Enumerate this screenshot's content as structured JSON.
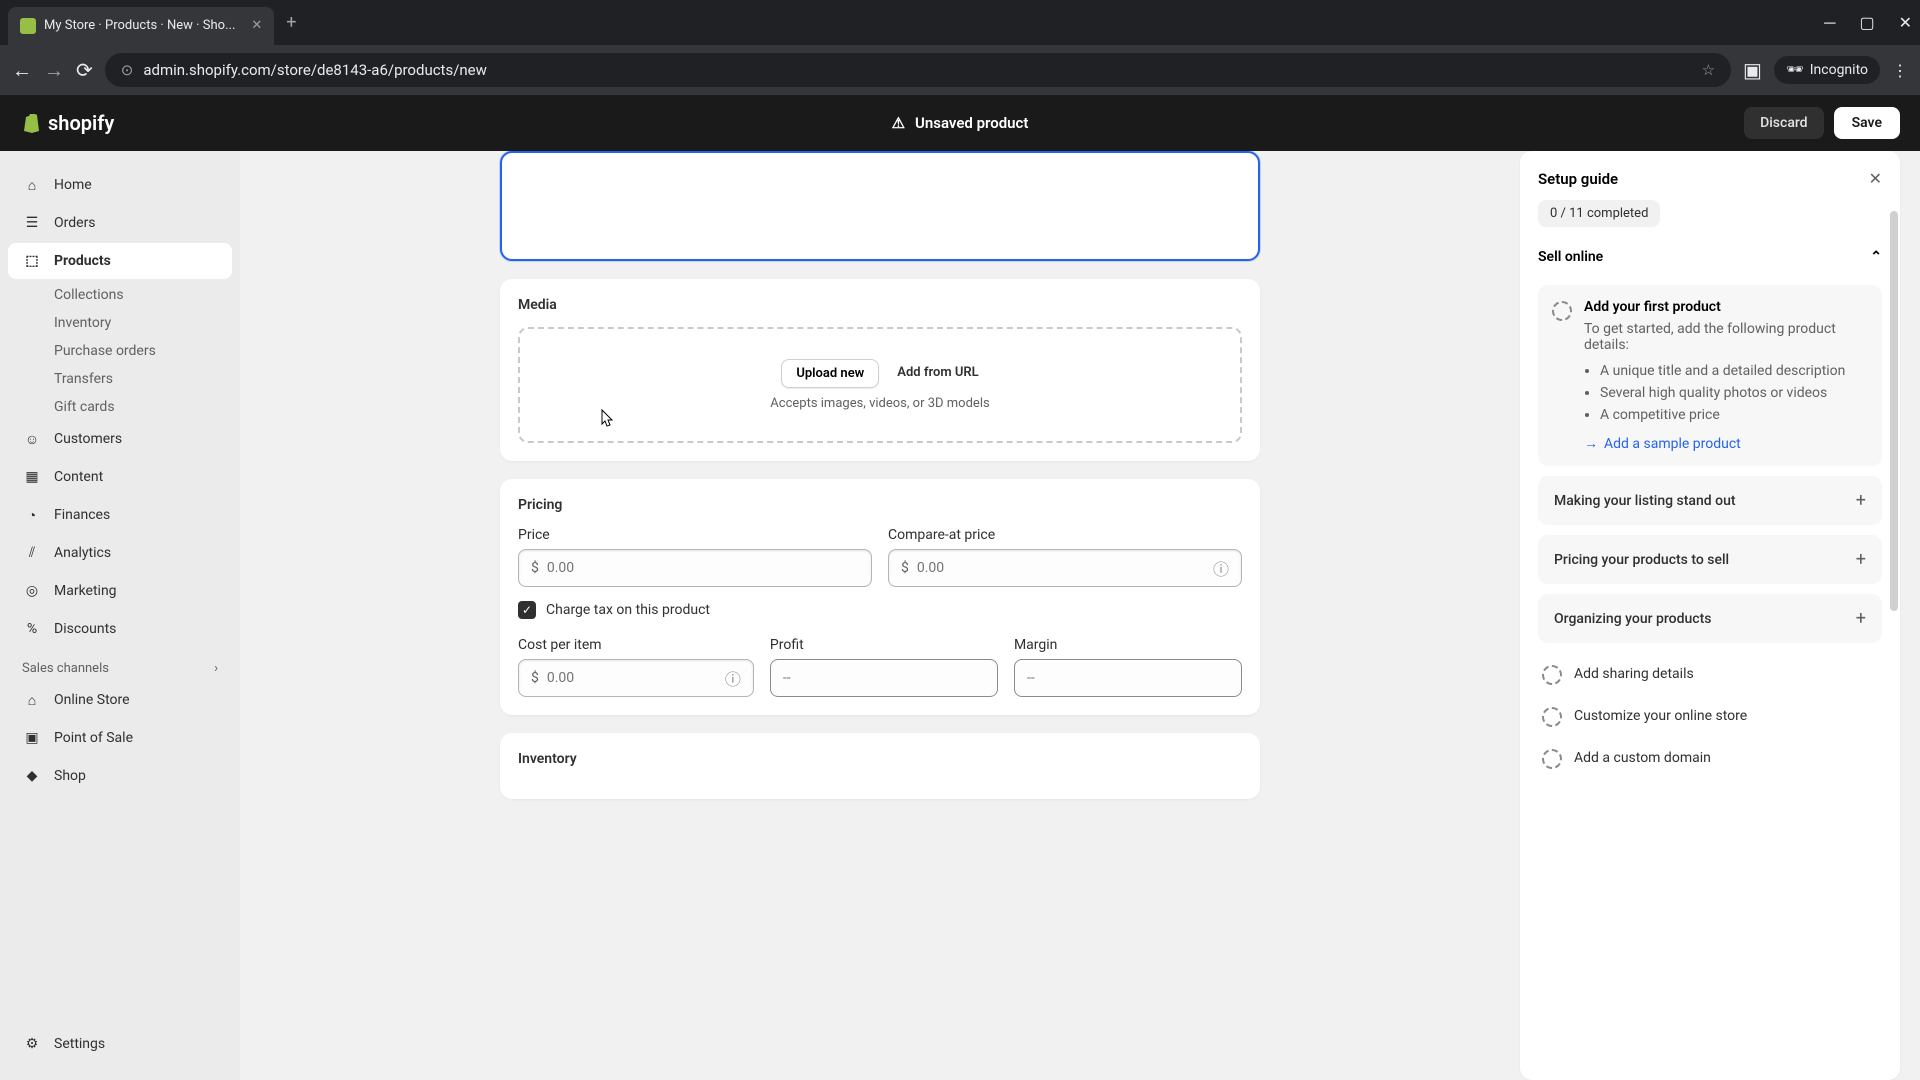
{
  "browser": {
    "tab_title": "My Store · Products · New · Sho...",
    "url": "admin.shopify.com/store/de8143-a6/products/new",
    "incognito_label": "Incognito"
  },
  "topbar": {
    "logo_text": "shopify",
    "status": "Unsaved product",
    "discard_label": "Discard",
    "save_label": "Save"
  },
  "sidebar": {
    "home": "Home",
    "orders": "Orders",
    "products": "Products",
    "collections": "Collections",
    "inventory": "Inventory",
    "purchase_orders": "Purchase orders",
    "transfers": "Transfers",
    "gift_cards": "Gift cards",
    "customers": "Customers",
    "content": "Content",
    "finances": "Finances",
    "analytics": "Analytics",
    "marketing": "Marketing",
    "discounts": "Discounts",
    "sales_channels": "Sales channels",
    "online_store": "Online Store",
    "point_of_sale": "Point of Sale",
    "shop": "Shop",
    "settings": "Settings"
  },
  "media": {
    "title": "Media",
    "upload_label": "Upload new",
    "url_label": "Add from URL",
    "hint": "Accepts images, videos, or 3D models"
  },
  "pricing": {
    "title": "Pricing",
    "price_label": "Price",
    "compare_label": "Compare-at price",
    "price_placeholder": "0.00",
    "compare_placeholder": "0.00",
    "currency": "$",
    "tax_label": "Charge tax on this product",
    "cost_label": "Cost per item",
    "cost_placeholder": "0.00",
    "profit_label": "Profit",
    "profit_placeholder": "--",
    "margin_label": "Margin",
    "margin_placeholder": "--"
  },
  "inventory": {
    "title": "Inventory"
  },
  "setup": {
    "title": "Setup guide",
    "progress": "0 / 11 completed",
    "section_sell": "Sell online",
    "task1_title": "Add your first product",
    "task1_desc": "To get started, add the following product details:",
    "task1_item1": "A unique title and a detailed description",
    "task1_item2": "Several high quality photos or videos",
    "task1_item3": "A competitive price",
    "task1_link": "Add a sample product",
    "task2": "Making your listing stand out",
    "task3": "Pricing your products to sell",
    "task4": "Organizing your products",
    "task5": "Add sharing details",
    "task6": "Customize your online store",
    "task7": "Add a custom domain"
  }
}
